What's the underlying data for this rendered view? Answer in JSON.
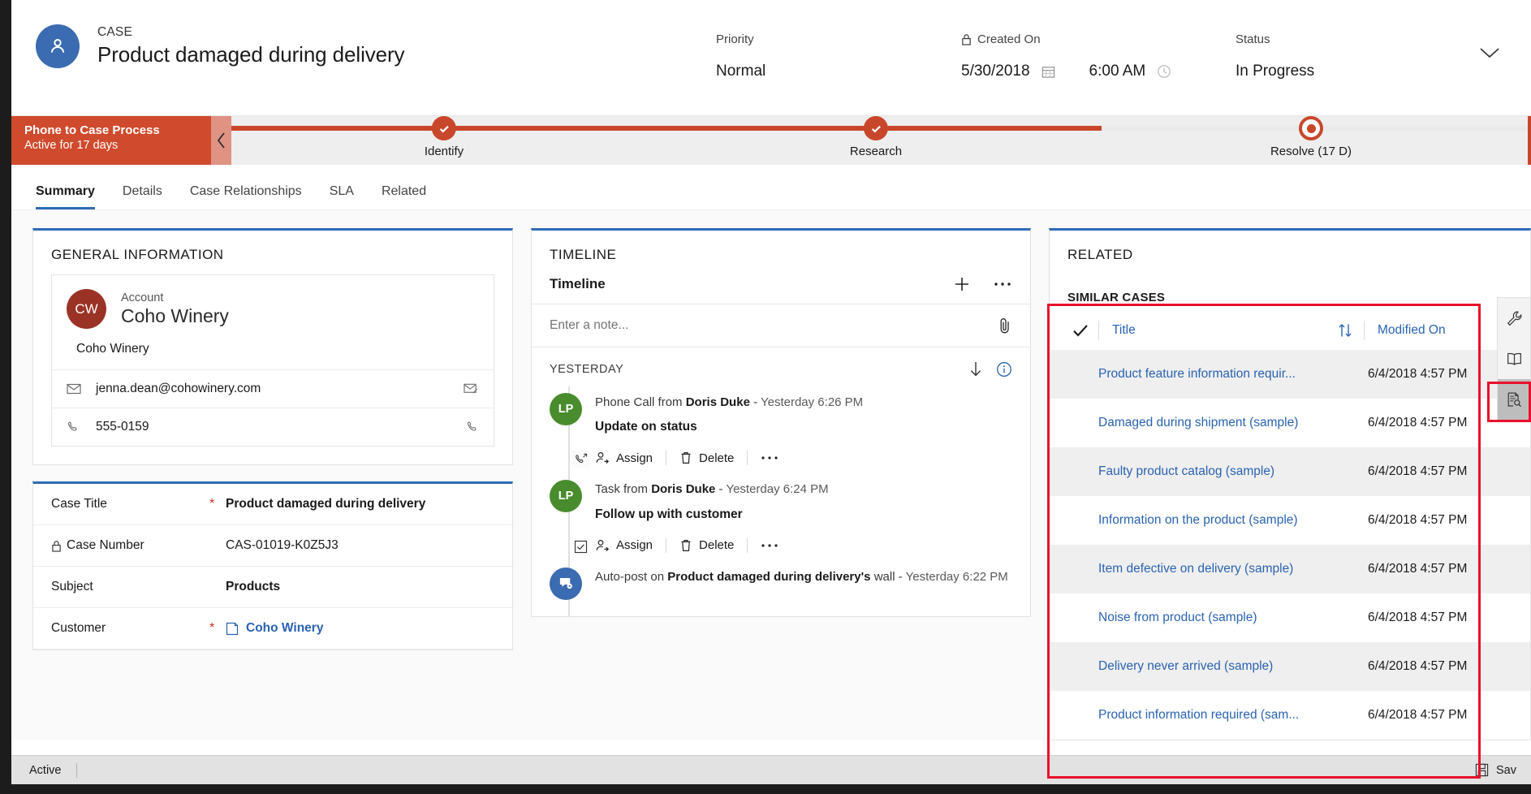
{
  "header": {
    "entity_label": "CASE",
    "record_title": "Product damaged during delivery",
    "fields": {
      "priority_label": "Priority",
      "priority_value": "Normal",
      "created_label": "Created On",
      "created_date": "5/30/2018",
      "created_time": "6:00 AM",
      "status_label": "Status",
      "status_value": "In Progress"
    }
  },
  "process": {
    "name": "Phone to Case Process",
    "active_for": "Active for 17 days",
    "stages": [
      {
        "label": "Identify",
        "state": "complete"
      },
      {
        "label": "Research",
        "state": "complete"
      },
      {
        "label": "Resolve  (17 D)",
        "state": "active"
      }
    ]
  },
  "tabs": [
    {
      "label": "Summary",
      "active": true
    },
    {
      "label": "Details",
      "active": false
    },
    {
      "label": "Case Relationships",
      "active": false
    },
    {
      "label": "SLA",
      "active": false
    },
    {
      "label": "Related",
      "active": false
    }
  ],
  "general_information": {
    "section_title": "GENERAL INFORMATION",
    "account": {
      "initials": "CW",
      "label": "Account",
      "name": "Coho Winery",
      "company": "Coho Winery",
      "email": "jenna.dean@cohowinery.com",
      "phone": "555-0159"
    },
    "fields": [
      {
        "label": "Case Title",
        "value": "Product damaged during delivery",
        "required": true,
        "locked": false,
        "link": false
      },
      {
        "label": "Case Number",
        "value": "CAS-01019-K0Z5J3",
        "required": false,
        "locked": true,
        "link": false
      },
      {
        "label": "Subject",
        "value": "Products",
        "required": false,
        "locked": false,
        "link": false
      },
      {
        "label": "Customer",
        "value": "Coho Winery",
        "required": true,
        "locked": false,
        "link": true
      }
    ]
  },
  "timeline": {
    "section_title": "TIMELINE",
    "sub_title": "Timeline",
    "note_placeholder": "Enter a note...",
    "day_group": "YESTERDAY",
    "entries": [
      {
        "kind": "Phone Call",
        "prefix": "Phone Call from ",
        "actor": "Doris Duke",
        "dash": " - ",
        "time": "Yesterday 6:26 PM",
        "summary": "Update on status",
        "initials": "LP",
        "avatar_color": "#498c2e",
        "badge": "phone-icon",
        "actions": [
          "Assign",
          "Delete",
          "..."
        ]
      },
      {
        "kind": "Task",
        "prefix": "Task from ",
        "actor": "Doris Duke",
        "dash": " - ",
        "time": "Yesterday 6:24 PM",
        "summary": "Follow up with customer",
        "initials": "LP",
        "avatar_color": "#498c2e",
        "badge": "task-check-icon",
        "actions": [
          "Assign",
          "Delete",
          "..."
        ]
      },
      {
        "kind": "Auto-post",
        "prefix": "Auto-post on ",
        "actor": "Product damaged during delivery's",
        "dash": " wall -  ",
        "time": "Yesterday 6:22 PM",
        "summary": "",
        "initials": "",
        "avatar_color": "#3b6bb0",
        "badge": "post-gear-icon",
        "actions": []
      }
    ]
  },
  "related": {
    "section_title": "RELATED",
    "similar_cases": {
      "title": "SIMILAR CASES",
      "columns": {
        "title": "Title",
        "modified_on": "Modified On"
      },
      "rows": [
        {
          "title": "Product feature information requir...",
          "modified_on": "6/4/2018 4:57 PM"
        },
        {
          "title": "Damaged during shipment (sample)",
          "modified_on": "6/4/2018 4:57 PM"
        },
        {
          "title": "Faulty product catalog (sample)",
          "modified_on": "6/4/2018 4:57 PM"
        },
        {
          "title": "Information on the product (sample)",
          "modified_on": "6/4/2018 4:57 PM"
        },
        {
          "title": "Item defective on delivery (sample)",
          "modified_on": "6/4/2018 4:57 PM"
        },
        {
          "title": "Noise from product (sample)",
          "modified_on": "6/4/2018 4:57 PM"
        },
        {
          "title": "Delivery never arrived (sample)",
          "modified_on": "6/4/2018 4:57 PM"
        },
        {
          "title": "Product information required (sam...",
          "modified_on": "6/4/2018 4:57 PM"
        }
      ]
    }
  },
  "rail": [
    {
      "icon": "wrench-icon",
      "selected": false
    },
    {
      "icon": "book-icon",
      "selected": false
    },
    {
      "icon": "document-search-icon",
      "selected": true
    }
  ],
  "footer": {
    "status": "Active",
    "save_label": "Sav"
  },
  "colors": {
    "process_red": "#c8472b",
    "accent_blue": "#2f6cb5",
    "link_blue": "#2a63b0",
    "annotation_red": "#e8112d",
    "account_avatar": "#9b3226",
    "case_avatar": "#3b6bb0",
    "timeline_avatar": "#498c2e"
  }
}
